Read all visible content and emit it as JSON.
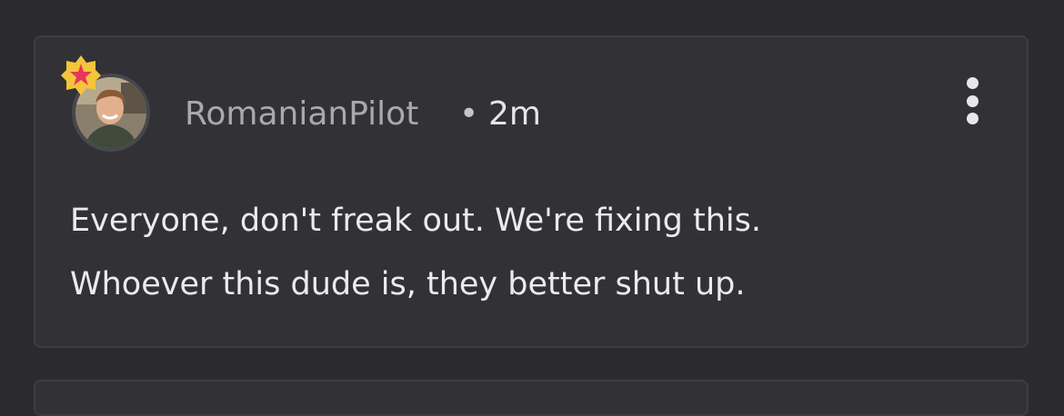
{
  "comment": {
    "username": "RomanianPilot",
    "separator": "•",
    "timestamp": "2m",
    "lines": [
      "Everyone, don't freak out. We're fixing this.",
      "Whoever this dude is, they better shut up."
    ]
  },
  "icons": {
    "badge": "star-badge-icon",
    "menu": "more-vertical-icon"
  },
  "colors": {
    "background": "#2b2b2f",
    "card": "#323236",
    "badge_gold": "#f4c53b",
    "badge_star": "#e8355a"
  }
}
